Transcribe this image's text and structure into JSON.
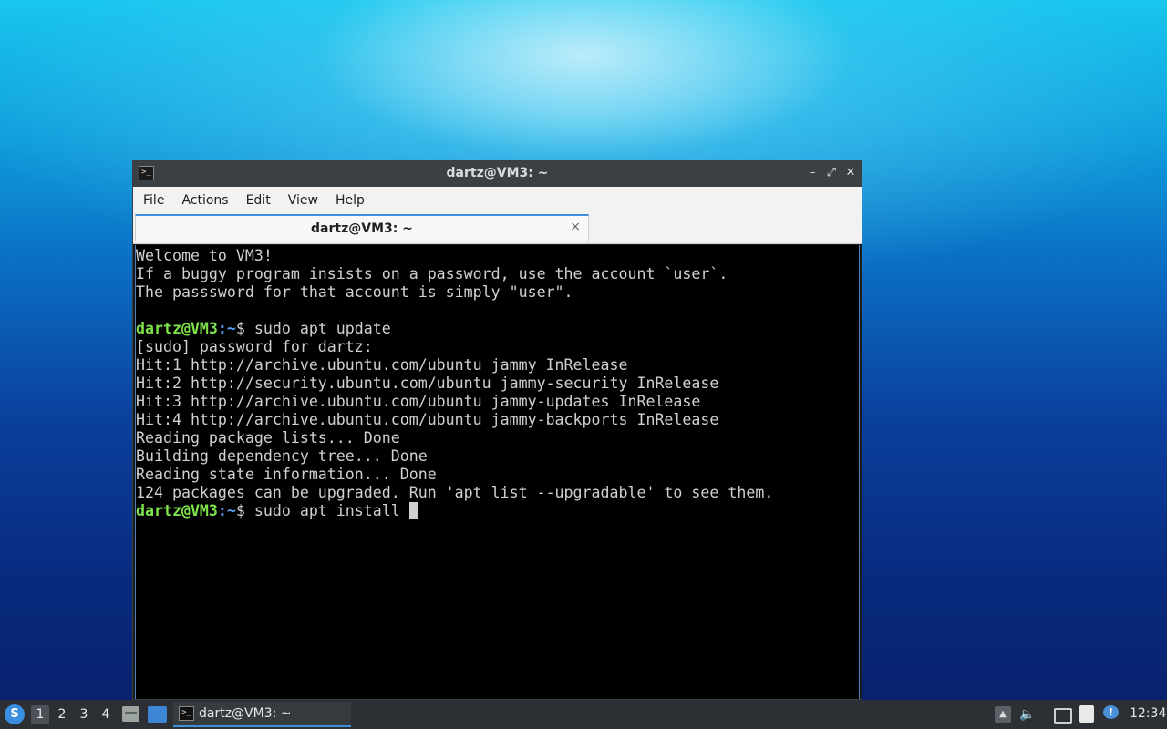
{
  "window": {
    "title": "dartz@VM3: ~",
    "minimize_glyph": "–",
    "maximize_glyph": "⤢",
    "close_glyph": "✕",
    "app_icon_glyph": ">_"
  },
  "menu": {
    "items": [
      "File",
      "Actions",
      "Edit",
      "View",
      "Help"
    ]
  },
  "tab": {
    "label": "dartz@VM3: ~",
    "close_glyph": "×"
  },
  "terminal": {
    "lines": [
      {
        "type": "text",
        "text": "Welcome to VM3!"
      },
      {
        "type": "text",
        "text": "If a buggy program insists on a password, use the account `user`."
      },
      {
        "type": "text",
        "text": "The passsword for that account is simply \"user\"."
      },
      {
        "type": "text",
        "text": ""
      },
      {
        "type": "prompt",
        "user": "dartz@VM3",
        "path": ":~",
        "symbol": "$",
        "command": " sudo apt update"
      },
      {
        "type": "text",
        "text": "[sudo] password for dartz:"
      },
      {
        "type": "text",
        "text": "Hit:1 http://archive.ubuntu.com/ubuntu jammy InRelease"
      },
      {
        "type": "text",
        "text": "Hit:2 http://security.ubuntu.com/ubuntu jammy-security InRelease"
      },
      {
        "type": "text",
        "text": "Hit:3 http://archive.ubuntu.com/ubuntu jammy-updates InRelease"
      },
      {
        "type": "text",
        "text": "Hit:4 http://archive.ubuntu.com/ubuntu jammy-backports InRelease"
      },
      {
        "type": "text",
        "text": "Reading package lists... Done"
      },
      {
        "type": "text",
        "text": "Building dependency tree... Done"
      },
      {
        "type": "text",
        "text": "Reading state information... Done"
      },
      {
        "type": "text",
        "text": "124 packages can be upgraded. Run 'apt list --upgradable' to see them."
      },
      {
        "type": "prompt",
        "user": "dartz@VM3",
        "path": ":~",
        "symbol": "$",
        "command": " sudo apt install ",
        "cursor": true
      }
    ],
    "colors": {
      "user": "#7ee24a",
      "path": "#5aa0ff",
      "text": "#d0d0d0",
      "background": "#000000"
    }
  },
  "taskbar": {
    "start_icon": "start-menu-icon",
    "workspaces": [
      "1",
      "2",
      "3",
      "4"
    ],
    "active_workspace": "1",
    "task_label": "dartz@VM3: ~",
    "task_icon_glyph": ">_",
    "tray_icons": [
      "tray-up-arrow-icon",
      "volume-icon",
      "network-icon",
      "clipboard-icon",
      "notification-icon"
    ],
    "clock": "12:34",
    "up_glyph": "▲",
    "volume_glyph": "🔈",
    "notification_glyph": "!",
    "start_glyph": "S"
  }
}
